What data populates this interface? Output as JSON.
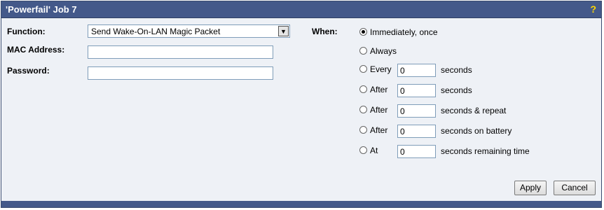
{
  "title": "'Powerfail' Job 7",
  "help_label": "?",
  "function": {
    "label": "Function:",
    "value": "Send Wake-On-LAN Magic Packet",
    "arrow": "▼"
  },
  "mac": {
    "label": "MAC Address:",
    "value": ""
  },
  "password": {
    "label": "Password:",
    "value": ""
  },
  "when": {
    "label": "When:",
    "options": [
      {
        "label": "Immediately, once",
        "selected": true
      },
      {
        "label": "Always",
        "selected": false
      },
      {
        "label": "Every",
        "value": "0",
        "unit": "seconds",
        "selected": false
      },
      {
        "label": "After",
        "value": "0",
        "unit": "seconds",
        "selected": false
      },
      {
        "label": "After",
        "value": "0",
        "unit": "seconds & repeat",
        "selected": false
      },
      {
        "label": "After",
        "value": "0",
        "unit": "seconds on battery",
        "selected": false
      },
      {
        "label": "At",
        "value": "0",
        "unit": "seconds remaining time",
        "selected": false
      }
    ]
  },
  "buttons": {
    "apply": "Apply",
    "cancel": "Cancel"
  },
  "colors": {
    "titlebar": "#44598a",
    "panel": "#eef1f6",
    "help": "#ffd700"
  }
}
